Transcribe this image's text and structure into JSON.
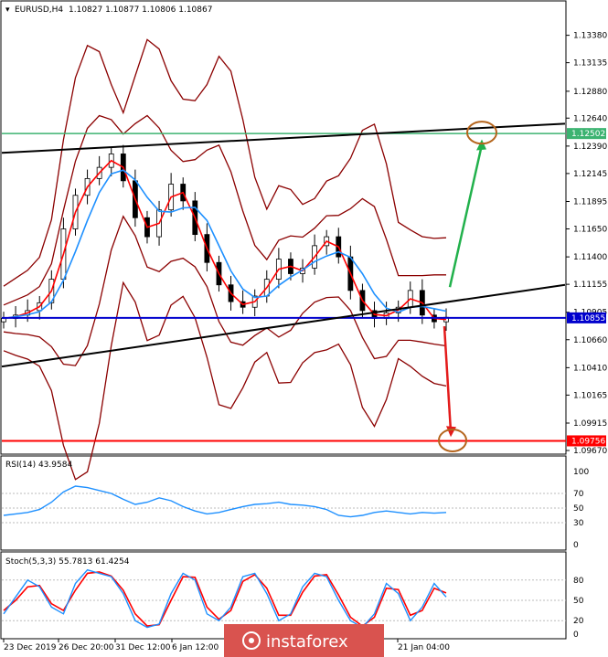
{
  "header": {
    "symbol": "EURUSD,H4",
    "ohlc": "1.10827 1.10877 1.10806 1.10867"
  },
  "rsi_header": "RSI(14) 43.9584",
  "stoch_header": "Stoch(5,3,3) 55.7813 61.4254",
  "watermark": "instaforex",
  "colors": {
    "upper_line": "#3cb371",
    "lower_line": "#ff0000",
    "current_line": "#0000cd",
    "bollinger": "#8b0000",
    "ma_fast": "#ff0000",
    "ma_slow": "#1e90ff",
    "trendline": "#000000",
    "arrow_up": "#22b14c",
    "arrow_down": "#e31b1b",
    "target_circle": "#b5651d",
    "stoch_main": "#1e90ff",
    "stoch_signal": "#ff0000",
    "rsi_line": "#1e90ff",
    "watermark_bg": "#d9534f"
  },
  "chart_data": [
    {
      "type": "candlestick",
      "symbol": "EURUSD",
      "timeframe": "H4",
      "y_ticks": [
        "1.13380",
        "1.13135",
        "1.12880",
        "1.12640",
        "1.12390",
        "1.12145",
        "1.11895",
        "1.11650",
        "1.11400",
        "1.11155",
        "1.10905",
        "1.10660",
        "1.10410",
        "1.10165",
        "1.09915",
        "1.09670"
      ],
      "ylim": [
        1.0967,
        1.1363
      ],
      "x_tick_labels": [
        "23 Dec 2019",
        "26 Dec 20:00",
        "31 Dec 12:00",
        "6 Jan 12:00",
        "21 Jan 04:00"
      ],
      "levels": [
        {
          "name": "upper",
          "value": 1.12502,
          "label": "1.12502"
        },
        {
          "name": "current",
          "value": 1.10855,
          "label": "1.10855"
        },
        {
          "name": "lower",
          "value": 1.09756,
          "label": "1.09756"
        }
      ],
      "trendlines": [
        {
          "from": [
            0,
            1.1233
          ],
          "to": [
            1,
            1.1259
          ]
        },
        {
          "from": [
            0,
            1.1042
          ],
          "to": [
            1,
            1.1115
          ]
        }
      ],
      "close_path": [
        1.1085,
        1.1088,
        1.1092,
        1.1099,
        1.112,
        1.1165,
        1.1195,
        1.121,
        1.122,
        1.1232,
        1.1208,
        1.1175,
        1.1158,
        1.1182,
        1.1205,
        1.119,
        1.116,
        1.1135,
        1.1115,
        1.11,
        1.1095,
        1.1105,
        1.112,
        1.1138,
        1.1125,
        1.113,
        1.115,
        1.1158,
        1.114,
        1.111,
        1.1092,
        1.1085,
        1.109,
        1.1095,
        1.111,
        1.1088,
        1.1082,
        1.1086
      ]
    },
    {
      "type": "line",
      "name": "RSI(14)",
      "value": 43.9584,
      "ylim": [
        0,
        100
      ],
      "y_ticks": [
        "100",
        "70",
        "50",
        "30",
        "0"
      ],
      "values": [
        40,
        42,
        44,
        48,
        58,
        72,
        80,
        78,
        74,
        70,
        62,
        55,
        58,
        64,
        60,
        52,
        46,
        42,
        44,
        48,
        52,
        55,
        56,
        58,
        55,
        54,
        52,
        48,
        40,
        38,
        40,
        44,
        46,
        44,
        42,
        44,
        43,
        44
      ]
    },
    {
      "type": "line",
      "name": "Stoch(5,3,3)",
      "main": 55.7813,
      "signal": 61.4254,
      "ylim": [
        0,
        100
      ],
      "y_ticks": [
        "80",
        "50",
        "20",
        "0"
      ],
      "main_values": [
        30,
        55,
        80,
        70,
        40,
        30,
        75,
        95,
        90,
        85,
        60,
        20,
        10,
        15,
        60,
        90,
        80,
        30,
        20,
        40,
        85,
        90,
        60,
        20,
        30,
        70,
        90,
        85,
        50,
        20,
        10,
        30,
        75,
        60,
        20,
        40,
        75,
        55
      ],
      "signal_values": [
        35,
        50,
        70,
        72,
        45,
        35,
        65,
        90,
        92,
        86,
        65,
        30,
        12,
        14,
        50,
        85,
        84,
        40,
        22,
        35,
        78,
        88,
        68,
        28,
        28,
        62,
        86,
        88,
        58,
        25,
        12,
        25,
        68,
        66,
        28,
        35,
        68,
        61
      ]
    }
  ]
}
